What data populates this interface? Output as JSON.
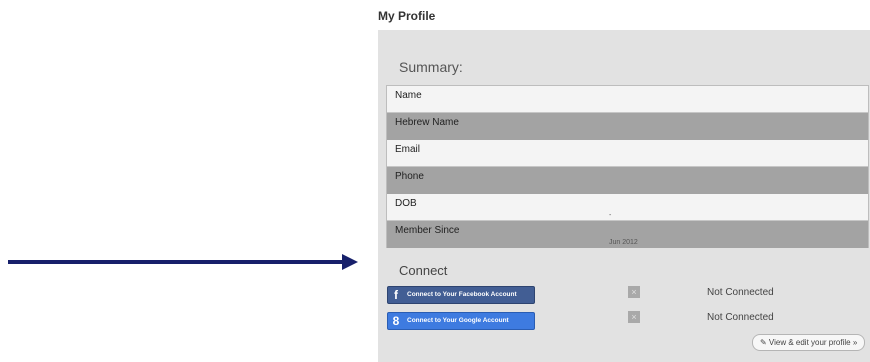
{
  "page": {
    "title": "My Profile"
  },
  "summary": {
    "title": "Summary:",
    "rows": [
      {
        "label": "Name",
        "value": ""
      },
      {
        "label": "Hebrew Name",
        "value": ""
      },
      {
        "label": "Email",
        "value": ""
      },
      {
        "label": "Phone",
        "value": ""
      },
      {
        "label": "DOB",
        "value": "-"
      },
      {
        "label": "Member Since",
        "value": "Jun 2012"
      }
    ]
  },
  "connect": {
    "title": "Connect",
    "facebook": {
      "label": "Connect to Your Facebook Account",
      "icon": "f",
      "status": "Not Connected",
      "remove": "×"
    },
    "google": {
      "label": "Connect to Your Google Account",
      "icon": "8",
      "status": "Not Connected",
      "remove": "×"
    }
  },
  "actions": {
    "view_edit": "✎ View & edit your profile »"
  },
  "colors": {
    "arrow": "#17206b",
    "facebook": "#425e94",
    "google": "#3e7be0",
    "panel": "#e2e2e2"
  }
}
